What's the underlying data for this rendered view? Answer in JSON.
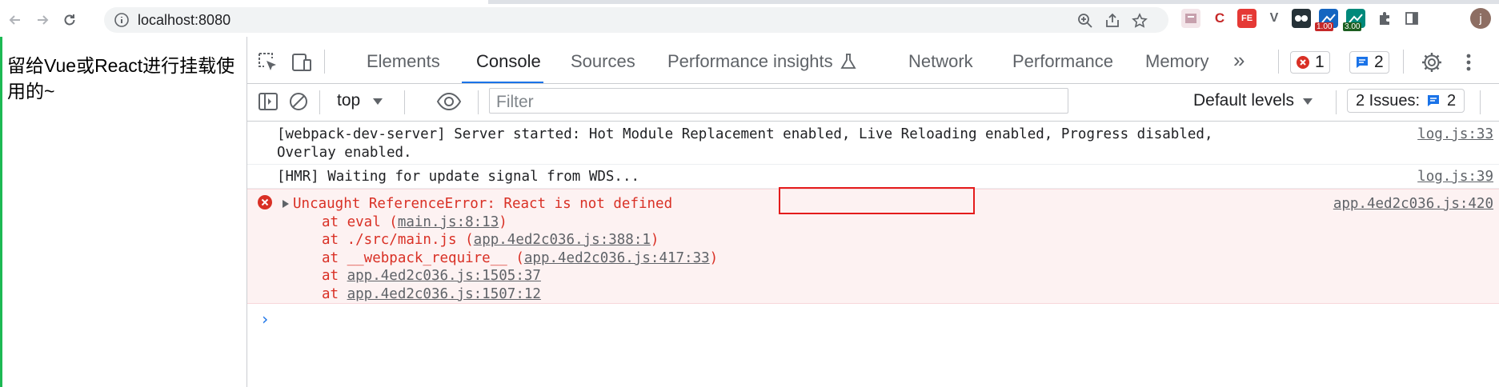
{
  "browser": {
    "url": "localhost:8080",
    "avatar_letter": "j",
    "extensions": [
      {
        "name": "bookmark-ext",
        "color": "#e8b4c0",
        "label": ""
      },
      {
        "name": "c-ext",
        "color": "#ffffff",
        "label": "C"
      },
      {
        "name": "fe-ext",
        "color": "#e53935",
        "label": "FE"
      },
      {
        "name": "v-ext",
        "color": "#ffffff",
        "label": "V"
      },
      {
        "name": "game-ext",
        "color": "#263238",
        "label": ""
      },
      {
        "name": "chart-ext-1",
        "color": "#1565c0",
        "label": "",
        "badge": "1.00",
        "badge_color": "#c62828"
      },
      {
        "name": "chart-ext-2",
        "color": "#00897b",
        "label": "",
        "badge": "3.00",
        "badge_color": "#1b5e20"
      }
    ]
  },
  "page": {
    "text": "留给Vue或React进行挂载使用的~"
  },
  "devtools": {
    "tabs": [
      "Elements",
      "Console",
      "Sources",
      "Performance insights",
      "Network",
      "Performance",
      "Memory"
    ],
    "active_tab": "Console",
    "error_count": "1",
    "message_count": "2",
    "context": "top",
    "filter_placeholder": "Filter",
    "levels_label": "Default levels",
    "issues_label": "2 Issues:",
    "issues_count": "2",
    "messages": [
      {
        "type": "log",
        "lines": [
          "[webpack-dev-server] Server started: Hot Module Replacement enabled, Live Reloading enabled, Progress disabled,",
          "Overlay enabled."
        ],
        "source": "log.js:33"
      },
      {
        "type": "log",
        "lines": [
          "[HMR] Waiting for update signal from WDS..."
        ],
        "source": "log.js:39"
      },
      {
        "type": "error",
        "head_prefix": "Uncaught ReferenceError: ",
        "head_highlight": "React is not defined",
        "source": "app.4ed2c036.js:420",
        "stack": [
          {
            "pre": "at eval (",
            "link": "main.js:8:13",
            "post": ")"
          },
          {
            "pre": "at ./src/main.js (",
            "link": "app.4ed2c036.js:388:1",
            "post": ")"
          },
          {
            "pre": "at __webpack_require__ (",
            "link": "app.4ed2c036.js:417:33",
            "post": ")"
          },
          {
            "pre": "at ",
            "link": "app.4ed2c036.js:1505:37",
            "post": ""
          },
          {
            "pre": "at ",
            "link": "app.4ed2c036.js:1507:12",
            "post": ""
          }
        ]
      }
    ],
    "colors": {
      "accent": "#1a73e8",
      "error": "#d93025",
      "error_bg": "#fdf2f2",
      "highlight_box": "#e41c1c"
    }
  }
}
